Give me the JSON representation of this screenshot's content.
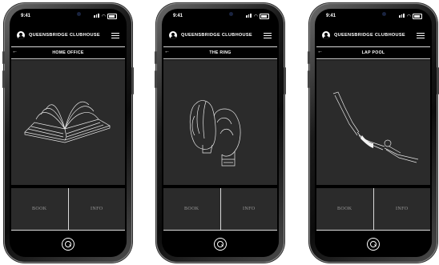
{
  "status_bar": {
    "time": "9:41"
  },
  "header": {
    "title": "QUEENSBRIDGE CLUBHOUSE",
    "profile_icon": "user-circle-icon",
    "menu_icon": "hamburger-menu-icon"
  },
  "screens": [
    {
      "room": "HOME OFFICE",
      "illustration": "open-book-icon",
      "book_label": "BOOK",
      "info_label": "INFO"
    },
    {
      "room": "THE RING",
      "illustration": "boxing-gloves-icon",
      "book_label": "BOOK",
      "info_label": "INFO"
    },
    {
      "room": "LAP POOL",
      "illustration": "diver-icon",
      "book_label": "BOOK",
      "info_label": "INFO"
    }
  ],
  "footer": {
    "logo_icon": "q-logo-icon"
  },
  "colors": {
    "screen_bg": "#000000",
    "panel_bg": "#2b2b2b",
    "divider": "#d9d9d9",
    "text": "#ffffff",
    "muted_text": "#9a9a9a"
  }
}
